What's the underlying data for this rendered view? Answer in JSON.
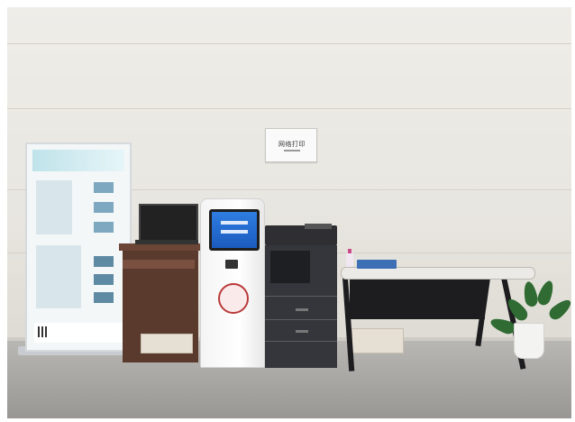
{
  "scene": {
    "sign_text": "网络打印",
    "banner_title": "",
    "kiosk_logo_text": "",
    "kiosk_brand_text": ""
  }
}
